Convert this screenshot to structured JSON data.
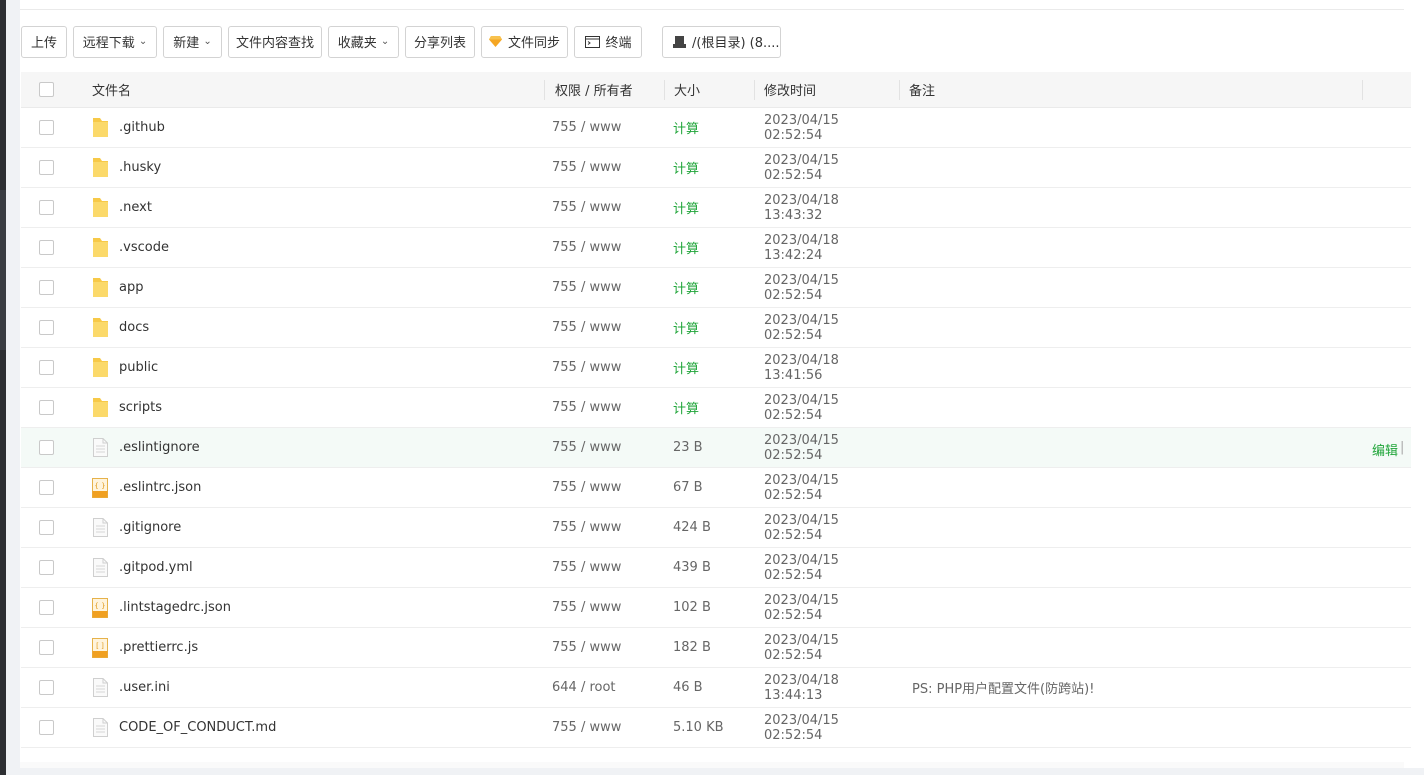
{
  "toolbar": {
    "upload": "上传",
    "remote_download": "远程下载",
    "new": "新建",
    "content_search": "文件内容查找",
    "favorites": "收藏夹",
    "share_list": "分享列表",
    "file_sync": "文件同步",
    "terminal": "终端",
    "path": "/(根目录) (8...."
  },
  "table": {
    "headers": {
      "name": "文件名",
      "perm": "权限 / 所有者",
      "size": "大小",
      "mtime": "修改时间",
      "note": "备注"
    },
    "rows": [
      {
        "name": ".github",
        "type": "folder",
        "perm": "755 / www",
        "size": "计算",
        "mtime": "2023/04/15 02:52:54",
        "note": ""
      },
      {
        "name": ".husky",
        "type": "folder",
        "perm": "755 / www",
        "size": "计算",
        "mtime": "2023/04/15 02:52:54",
        "note": ""
      },
      {
        "name": ".next",
        "type": "folder",
        "perm": "755 / www",
        "size": "计算",
        "mtime": "2023/04/18 13:43:32",
        "note": ""
      },
      {
        "name": ".vscode",
        "type": "folder",
        "perm": "755 / www",
        "size": "计算",
        "mtime": "2023/04/18 13:42:24",
        "note": ""
      },
      {
        "name": "app",
        "type": "folder",
        "perm": "755 / www",
        "size": "计算",
        "mtime": "2023/04/15 02:52:54",
        "note": ""
      },
      {
        "name": "docs",
        "type": "folder",
        "perm": "755 / www",
        "size": "计算",
        "mtime": "2023/04/15 02:52:54",
        "note": ""
      },
      {
        "name": "public",
        "type": "folder",
        "perm": "755 / www",
        "size": "计算",
        "mtime": "2023/04/18 13:41:56",
        "note": ""
      },
      {
        "name": "scripts",
        "type": "folder",
        "perm": "755 / www",
        "size": "计算",
        "mtime": "2023/04/15 02:52:54",
        "note": ""
      },
      {
        "name": ".eslintignore",
        "type": "file",
        "perm": "755 / www",
        "size": "23 B",
        "mtime": "2023/04/15 02:52:54",
        "note": "",
        "edit": "编辑"
      },
      {
        "name": ".eslintrc.json",
        "type": "json",
        "perm": "755 / www",
        "size": "67 B",
        "mtime": "2023/04/15 02:52:54",
        "note": ""
      },
      {
        "name": ".gitignore",
        "type": "file",
        "perm": "755 / www",
        "size": "424 B",
        "mtime": "2023/04/15 02:52:54",
        "note": ""
      },
      {
        "name": ".gitpod.yml",
        "type": "file",
        "perm": "755 / www",
        "size": "439 B",
        "mtime": "2023/04/15 02:52:54",
        "note": ""
      },
      {
        "name": ".lintstagedrc.json",
        "type": "json",
        "perm": "755 / www",
        "size": "102 B",
        "mtime": "2023/04/15 02:52:54",
        "note": ""
      },
      {
        "name": ".prettierrc.js",
        "type": "js",
        "perm": "755 / www",
        "size": "182 B",
        "mtime": "2023/04/15 02:52:54",
        "note": ""
      },
      {
        "name": ".user.ini",
        "type": "file",
        "perm": "644 / root",
        "size": "46 B",
        "mtime": "2023/04/18 13:44:13",
        "note": "PS: PHP用户配置文件(防跨站)!"
      },
      {
        "name": "CODE_OF_CONDUCT.md",
        "type": "file",
        "perm": "755 / www",
        "size": "5.10 KB",
        "mtime": "2023/04/15 02:52:54",
        "note": ""
      }
    ]
  },
  "colors": {
    "accent_green": "#20a53a",
    "folder_yellow": "#f7c948",
    "json_orange": "#f0a020"
  }
}
